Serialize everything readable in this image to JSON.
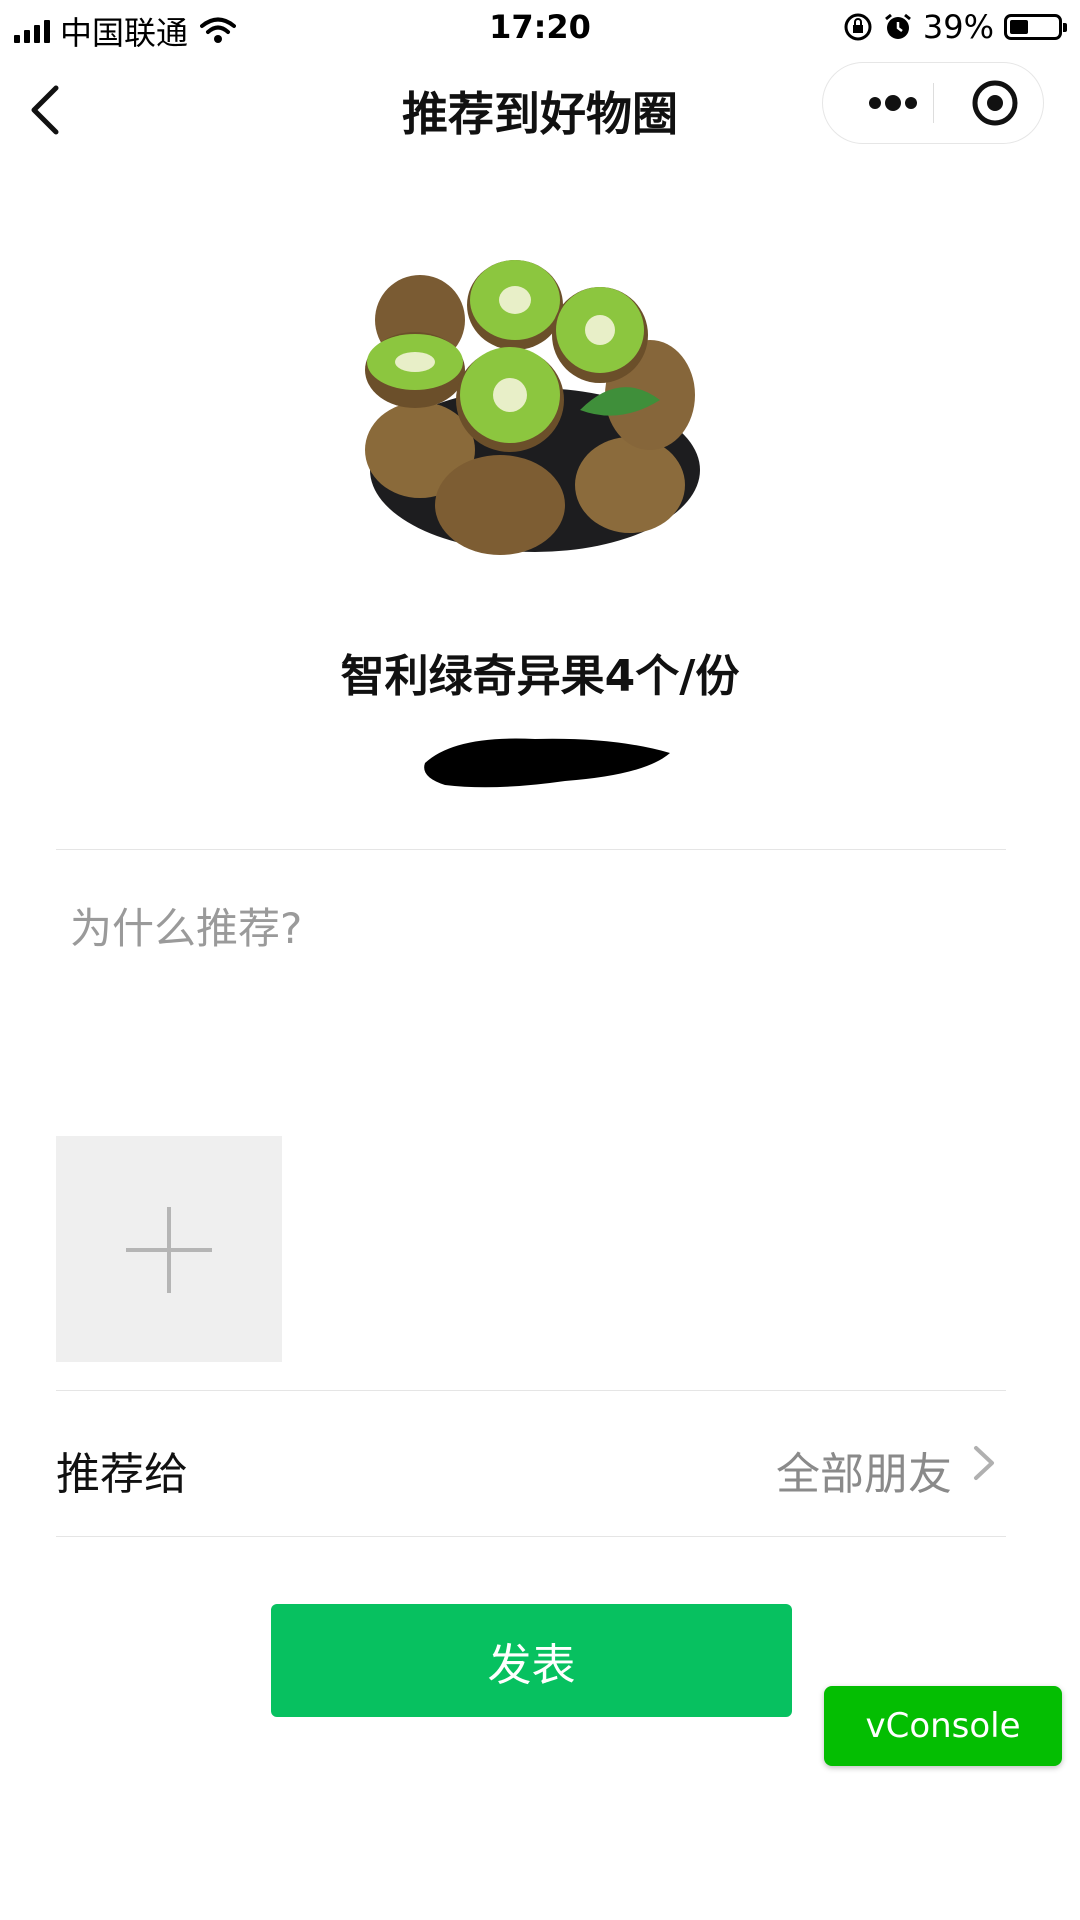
{
  "status_bar": {
    "carrier": "中国联通",
    "time": "17:20",
    "battery": "39%",
    "battery_level": 0.39,
    "icons": [
      "signal-icon",
      "wifi-icon",
      "orientation-lock-icon",
      "alarm-icon",
      "battery-icon"
    ]
  },
  "nav": {
    "title": "推荐到好物圈",
    "back_icon": "back-arrow-icon",
    "more_icon": "more-dots-icon",
    "close_icon": "target-close-icon"
  },
  "product": {
    "name": "智利绿奇异果4个/份",
    "image": "kiwi-fruit-image",
    "price_redacted": true
  },
  "form": {
    "reason_placeholder": "为什么推荐?",
    "add_image_icon": "plus-icon",
    "recommend_label": "推荐给",
    "recommend_value": "全部朋友"
  },
  "actions": {
    "publish_label": "发表",
    "vconsole_label": "vConsole"
  },
  "colors": {
    "primary_green": "#07c160",
    "vconsole_green": "#04be02",
    "placeholder_gray": "#9a9a9a",
    "secondary_text": "#8a8a8a"
  }
}
